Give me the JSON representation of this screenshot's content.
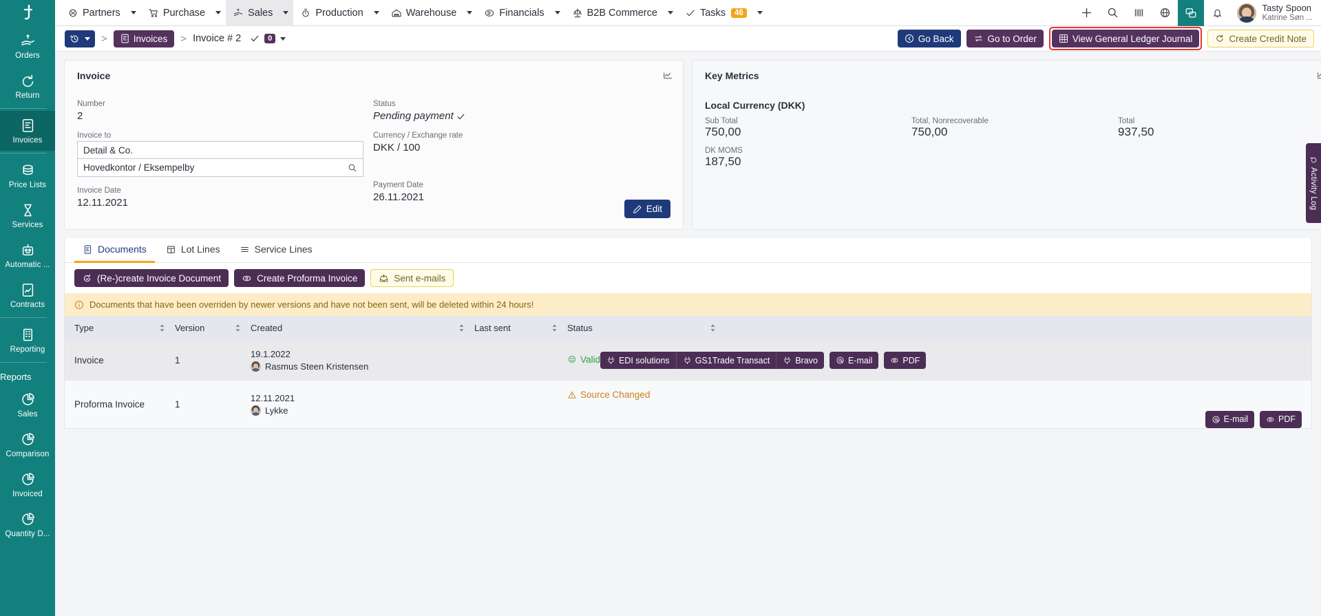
{
  "topbar": {
    "logo": "t-logo",
    "menu": [
      {
        "label": "Partners",
        "icon": "partners-icon",
        "caret": true,
        "active": false
      },
      {
        "label": "Purchase",
        "icon": "cart-icon",
        "caret": true,
        "active": false
      },
      {
        "label": "Sales",
        "icon": "sales-icon",
        "caret": true,
        "active": true
      },
      {
        "label": "Production",
        "icon": "production-icon",
        "caret": true,
        "active": false
      },
      {
        "label": "Warehouse",
        "icon": "warehouse-icon",
        "caret": true,
        "active": false
      },
      {
        "label": "Financials",
        "icon": "financials-icon",
        "caret": true,
        "active": false
      },
      {
        "label": "B2B Commerce",
        "icon": "b2b-icon",
        "caret": true,
        "active": false
      },
      {
        "label": "Tasks",
        "icon": "check-icon",
        "caret": true,
        "active": false,
        "badge": "46"
      }
    ],
    "right_icons": [
      "plus-icon",
      "search-icon",
      "barcode-icon",
      "globe-icon",
      "chat-icon",
      "bell-icon"
    ],
    "user": {
      "name": "Tasty Spoon",
      "sub": "Katrine Søn ..."
    }
  },
  "sidebar": {
    "groups": [
      {
        "items": [
          {
            "label": "Orders",
            "icon": "hand-money-icon",
            "active": false
          },
          {
            "label": "Return",
            "icon": "return-arrow-icon",
            "active": false
          }
        ]
      },
      {
        "items": [
          {
            "label": "Invoices",
            "icon": "invoice-doc-icon",
            "active": true
          }
        ]
      },
      {
        "items": [
          {
            "label": "Price Lists",
            "icon": "coins-icon",
            "active": false
          },
          {
            "label": "Services",
            "icon": "hourglass-icon",
            "active": false
          },
          {
            "label": "Automatic ...",
            "icon": "robot-icon",
            "active": false
          },
          {
            "label": "Contracts",
            "icon": "contract-doc-icon",
            "active": false
          }
        ]
      },
      {
        "items": [
          {
            "label": "Reporting",
            "icon": "building-icon",
            "active": false
          }
        ]
      },
      {
        "header": "Reports",
        "items": [
          {
            "label": "Sales",
            "icon": "pie-chart-icon",
            "active": false
          },
          {
            "label": "Comparison",
            "icon": "pie-chart-icon",
            "active": false
          },
          {
            "label": "Invoiced",
            "icon": "pie-chart-icon",
            "active": false
          },
          {
            "label": "Quantity D...",
            "icon": "pie-chart-icon",
            "active": false
          }
        ]
      }
    ]
  },
  "breadcrumb": {
    "history_icon": "history-icon",
    "items": [
      {
        "label": "Invoices",
        "icon": "invoice-doc-icon",
        "type": "chip"
      },
      {
        "label": "Invoice # 2",
        "type": "text"
      }
    ],
    "count_badge": "0",
    "separator": ">"
  },
  "actions": {
    "go_back": "Go Back",
    "go_to_order": "Go to Order",
    "view_gl_journal": "View General Ledger Journal",
    "create_credit_note": "Create Credit Note",
    "highlight_color": "#e8302a"
  },
  "invoice_card": {
    "title": "Invoice",
    "number_label": "Number",
    "number_value": "2",
    "invoice_to_label": "Invoice to",
    "invoice_to_company": "Detail & Co.",
    "invoice_to_address": "Hovedkontor / Eksempelby",
    "invoice_date_label": "Invoice Date",
    "invoice_date_value": "12.11.2021",
    "status_label": "Status",
    "status_value": "Pending payment",
    "currency_label": "Currency / Exchange rate",
    "currency_value": "DKK / 100",
    "payment_date_label": "Payment Date",
    "payment_date_value": "26.11.2021",
    "edit_label": "Edit"
  },
  "key_metrics": {
    "title": "Key Metrics",
    "currency_heading": "Local Currency (DKK)",
    "metrics": [
      {
        "label": "Sub Total",
        "value": "750,00"
      },
      {
        "label": "Total, Nonrecoverable",
        "value": "750,00"
      },
      {
        "label": "Total",
        "value": "937,50"
      }
    ],
    "tax": {
      "label": "DK MOMS",
      "value": "187,50"
    }
  },
  "tabs": [
    {
      "label": "Documents",
      "icon": "document-icon",
      "active": true
    },
    {
      "label": "Lot Lines",
      "icon": "calendar-icon",
      "active": false
    },
    {
      "label": "Service Lines",
      "icon": "list-icon",
      "active": false
    }
  ],
  "tab_actions": [
    {
      "label": "(Re-)create Invoice Document",
      "icon": "recreate-icon",
      "style": "purple"
    },
    {
      "label": "Create Proforma Invoice",
      "icon": "eye-icon",
      "style": "purple"
    },
    {
      "label": "Sent e-mails",
      "icon": "outbox-icon",
      "style": "yellow"
    }
  ],
  "alert": {
    "icon": "info-icon",
    "text": "Documents that have been overriden by newer versions and have not been sent, will be deleted within 24 hours!"
  },
  "table": {
    "columns": [
      "Type",
      "Version",
      "Created",
      "Last sent",
      "Status"
    ],
    "rows": [
      {
        "type": "Invoice",
        "version": "1",
        "created_date": "19.1.2022",
        "created_user": "Rasmus Steen Kristensen",
        "last_sent": "",
        "status": "Valid",
        "status_kind": "valid",
        "buttons_group": [
          "EDI solutions",
          "GS1Trade Transact",
          "Bravo"
        ],
        "buttons": [
          "E-mail",
          "PDF"
        ]
      },
      {
        "type": "Proforma Invoice",
        "version": "1",
        "created_date": "12.11.2021",
        "created_user": "Lykke",
        "last_sent": "",
        "status": "Source Changed",
        "status_kind": "warn",
        "buttons_group": [],
        "buttons": [
          "E-mail",
          "PDF"
        ]
      }
    ]
  },
  "activity_log": {
    "label": "Activity Log",
    "icon": "history-icon"
  }
}
